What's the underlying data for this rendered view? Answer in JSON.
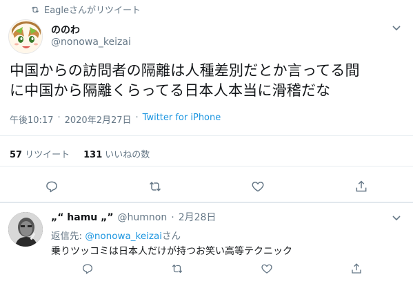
{
  "retweet": {
    "icon": "retweet-icon",
    "label": "Eagleさんがリツイート"
  },
  "main_tweet": {
    "name": "ののわ",
    "handle": "@nonowa_keizai",
    "text_line1": "中国からの訪問者の隔離は人種差別だとか言ってる間",
    "text_line2": "に中国から隔離くらってる日本人本当に滑稽だな",
    "time": "午後10:17",
    "date": "2020年2月27日",
    "source": "Twitter for iPhone",
    "retweet_count": "57",
    "retweet_label": "リツイート",
    "like_count": "131",
    "like_label": "いいねの数"
  },
  "reply_tweet": {
    "name": "„“ hamu „”",
    "handle": "@humnon",
    "date": "2月28日",
    "reply_prefix": "返信先: ",
    "reply_handle": "@nonowa_keizai",
    "reply_suffix": "さん",
    "text": "乗りツッコミは日本人だけが持つお笑い高等テクニック"
  },
  "colors": {
    "accent": "#1b95e0",
    "gray": "#657786",
    "divider": "#e6ecf0"
  },
  "icons": [
    "chevron-down-icon",
    "reply-icon",
    "retweet-icon",
    "like-icon",
    "share-icon"
  ]
}
